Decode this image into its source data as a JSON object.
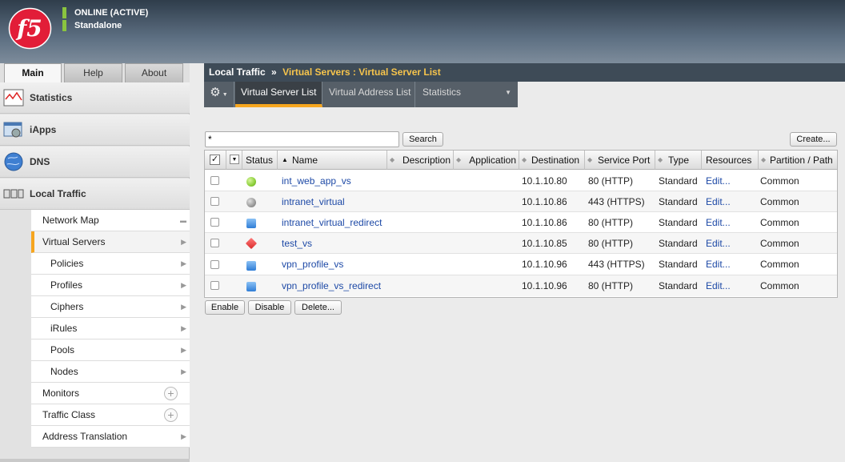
{
  "header": {
    "status_line": "ONLINE (ACTIVE)",
    "mode_line": "Standalone",
    "logo_text": "f5"
  },
  "nav_tabs": [
    {
      "label": "Main"
    },
    {
      "label": "Help"
    },
    {
      "label": "About"
    }
  ],
  "sidebar": {
    "sections": [
      {
        "label": "Statistics",
        "icon": "statistics-icon"
      },
      {
        "label": "iApps",
        "icon": "iapps-icon"
      },
      {
        "label": "DNS",
        "icon": "dns-globe-icon"
      },
      {
        "label": "Local Traffic",
        "icon": "local-traffic-icon"
      }
    ],
    "submenu": [
      {
        "label": "Network Map"
      },
      {
        "label": "Virtual Servers"
      },
      {
        "label": "Policies"
      },
      {
        "label": "Profiles"
      },
      {
        "label": "Ciphers"
      },
      {
        "label": "iRules"
      },
      {
        "label": "Pools"
      },
      {
        "label": "Nodes"
      },
      {
        "label": "Monitors"
      },
      {
        "label": "Traffic Class"
      },
      {
        "label": "Address Translation"
      }
    ]
  },
  "breadcrumb": {
    "root": "Local Traffic",
    "separator": "»",
    "tail": "Virtual Servers : Virtual Server List"
  },
  "subtabs": [
    {
      "label": "Virtual Server List"
    },
    {
      "label": "Virtual Address List"
    },
    {
      "label": "Statistics"
    }
  ],
  "search": {
    "value": "*",
    "button": "Search"
  },
  "create_button": "Create...",
  "table": {
    "headers": {
      "status": "Status",
      "name": "Name",
      "description": "Description",
      "application": "Application",
      "destination": "Destination",
      "service_port": "Service Port",
      "type": "Type",
      "resources": "Resources",
      "partition": "Partition / Path"
    },
    "rows": [
      {
        "status": "available",
        "status_color": "#8ccf3a",
        "name": "int_web_app_vs",
        "destination": "10.1.10.80",
        "service_port": "80 (HTTP)",
        "type": "Standard",
        "resources": "Edit...",
        "partition": "Common"
      },
      {
        "status": "unknown",
        "status_color": "#9a9a9a",
        "name": "intranet_virtual",
        "destination": "10.1.10.86",
        "service_port": "443 (HTTPS)",
        "type": "Standard",
        "resources": "Edit...",
        "partition": "Common"
      },
      {
        "status": "unknown",
        "status_color": "#3b8de0",
        "name": "intranet_virtual_redirect",
        "destination": "10.1.10.86",
        "service_port": "80 (HTTP)",
        "type": "Standard",
        "resources": "Edit...",
        "partition": "Common"
      },
      {
        "status": "offline",
        "status_color": "#d92b2b",
        "name": "test_vs",
        "destination": "10.1.10.85",
        "service_port": "80 (HTTP)",
        "type": "Standard",
        "resources": "Edit...",
        "partition": "Common"
      },
      {
        "status": "unknown",
        "status_color": "#3b8de0",
        "name": "vpn_profile_vs",
        "destination": "10.1.10.96",
        "service_port": "443 (HTTPS)",
        "type": "Standard",
        "resources": "Edit...",
        "partition": "Common"
      },
      {
        "status": "unknown",
        "status_color": "#3b8de0",
        "name": "vpn_profile_vs_redirect",
        "destination": "10.1.10.96",
        "service_port": "80 (HTTP)",
        "type": "Standard",
        "resources": "Edit...",
        "partition": "Common"
      }
    ]
  },
  "actions": {
    "enable": "Enable",
    "disable": "Disable",
    "delete": "Delete..."
  }
}
